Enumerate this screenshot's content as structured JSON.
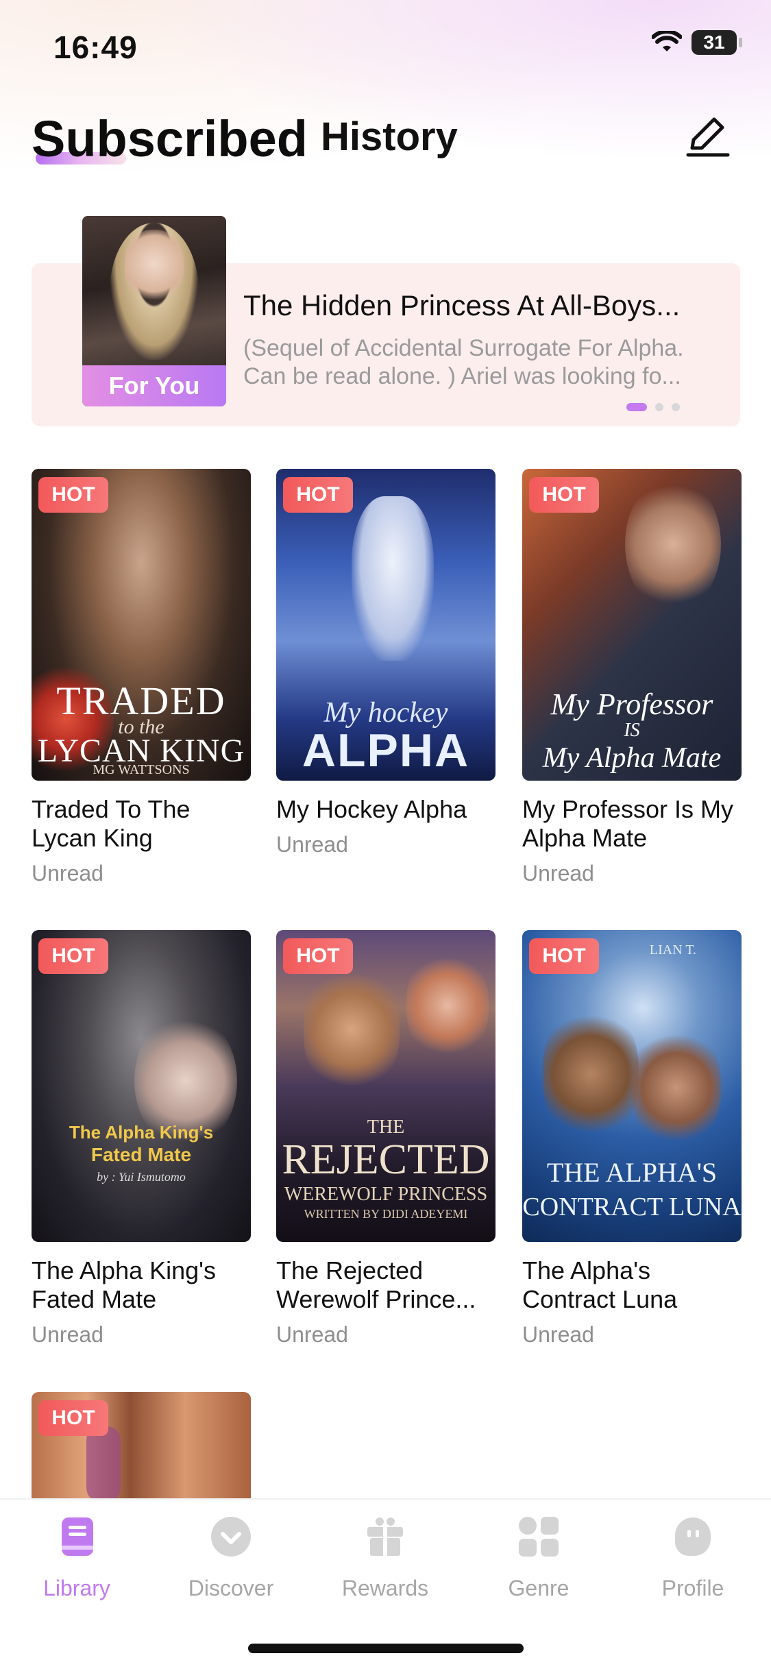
{
  "status_bar": {
    "time": "16:49",
    "battery": "31"
  },
  "header": {
    "tabs": [
      {
        "label": "Subscribed",
        "active": true
      },
      {
        "label": "History",
        "active": false
      }
    ]
  },
  "banner": {
    "badge": "For You",
    "title": "The Hidden Princess At All-Boys...",
    "description": "(Sequel of Accidental Surrogate For Alpha. Can be read alone. ) Ariel was looking fo...",
    "page_dots": 3,
    "active_dot": 0
  },
  "books": [
    {
      "title": "Traded To The Lycan King",
      "badge": "HOT",
      "status": "Unread",
      "cover_text": "TRADED",
      "cover_sub": "to the",
      "cover_text2": "LYCAN KING",
      "cover_author": "MG WATTSONS"
    },
    {
      "title": "My Hockey Alpha",
      "badge": "HOT",
      "status": "Unread",
      "cover_text": "My hockey",
      "cover_text2": "ALPHA"
    },
    {
      "title": "My Professor Is My Alpha Mate",
      "badge": "HOT",
      "status": "Unread",
      "cover_text": "My Professor",
      "cover_sub": "IS",
      "cover_text2": "My Alpha Mate"
    },
    {
      "title": "The Alpha King's Fated Mate",
      "badge": "HOT",
      "status": "Unread",
      "cover_text": "The Alpha King's",
      "cover_text2": "Fated Mate",
      "cover_author": "by : Yui Ismutomo"
    },
    {
      "title": "The Rejected Werewolf Prince...",
      "badge": "HOT",
      "status": "Unread",
      "cover_sub": "THE",
      "cover_text": "REJECTED",
      "cover_text2": "WEREWOLF PRINCESS",
      "cover_author": "WRITTEN BY DIDI ADEYEMI"
    },
    {
      "title": "The Alpha's Contract Luna",
      "badge": "HOT",
      "status": "Unread",
      "cover_author": "LIAN T.",
      "cover_text": "THE ALPHA'S",
      "cover_text2": "CONTRACT LUNA"
    },
    {
      "title": "",
      "badge": "HOT",
      "status": ""
    }
  ],
  "bottom_nav": [
    {
      "label": "Library",
      "icon": "book-icon",
      "active": true
    },
    {
      "label": "Discover",
      "icon": "compass-icon",
      "active": false
    },
    {
      "label": "Rewards",
      "icon": "gift-icon",
      "active": false
    },
    {
      "label": "Genre",
      "icon": "grid-icon",
      "active": false
    },
    {
      "label": "Profile",
      "icon": "profile-icon",
      "active": false
    }
  ],
  "colors": {
    "accent": "#c07aef",
    "hot_badge": "#f2595a",
    "banner_bg": "#fdeeee",
    "muted_text": "#8e8e8e"
  }
}
